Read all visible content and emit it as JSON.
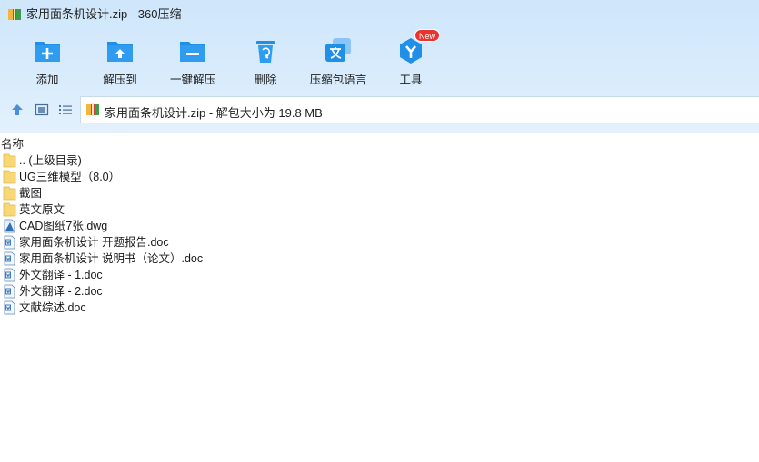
{
  "window": {
    "title": "家用面条机设计.zip - 360压缩"
  },
  "toolbar": {
    "buttons": [
      {
        "icon": "add-icon",
        "label": "添加"
      },
      {
        "icon": "extract-to-icon",
        "label": "解压到"
      },
      {
        "icon": "one-click-extract-icon",
        "label": "一键解压"
      },
      {
        "icon": "delete-icon",
        "label": "删除"
      },
      {
        "icon": "language-icon",
        "label": "压缩包语言"
      },
      {
        "icon": "tools-icon",
        "label": "工具",
        "badge": "New"
      }
    ]
  },
  "address": {
    "text": "家用面条机设计.zip - 解包大小为 19.8 MB"
  },
  "list": {
    "column_name": "名称",
    "items": [
      {
        "type": "folder",
        "name": ".. (上级目录)"
      },
      {
        "type": "folder",
        "name": "UG三维模型（8.0）"
      },
      {
        "type": "folder",
        "name": "截图"
      },
      {
        "type": "folder",
        "name": "英文原文"
      },
      {
        "type": "dwg",
        "name": "CAD图纸7张.dwg"
      },
      {
        "type": "doc",
        "name": "家用面条机设计 开题报告.doc"
      },
      {
        "type": "doc",
        "name": "家用面条机设计 说明书（论文）.doc"
      },
      {
        "type": "doc",
        "name": "外文翻译 - 1.doc"
      },
      {
        "type": "doc",
        "name": "外文翻译 - 2.doc"
      },
      {
        "type": "doc",
        "name": "文献综述.doc"
      }
    ]
  },
  "colors": {
    "accent": "#1f8fe8",
    "toolbar_bg": "#d6eafb",
    "folder": "#f8d775",
    "badge": "#e8342f"
  }
}
